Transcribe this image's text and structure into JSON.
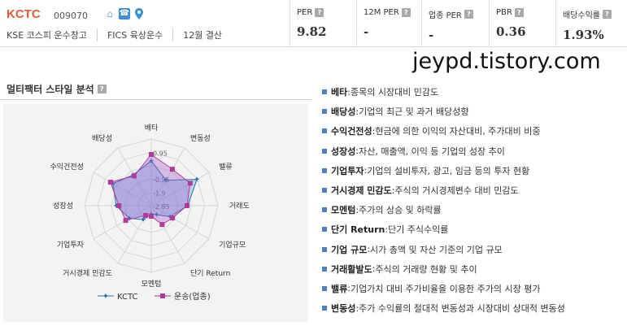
{
  "header": {
    "company_name": "KCTC",
    "company_code": "009070",
    "sub": [
      "KSE  코스피 운수창고",
      "FICS 육상운수",
      "12월 결산"
    ],
    "icons": [
      "home-icon",
      "phone-icon",
      "location-icon"
    ]
  },
  "metrics": [
    {
      "label": "PER",
      "value": "9.82"
    },
    {
      "label": "12M PER",
      "value": "-"
    },
    {
      "label": "업종 PER",
      "value": "-"
    },
    {
      "label": "PBR",
      "value": "0.36"
    },
    {
      "label": "배당수익률",
      "value": "1.93%"
    }
  ],
  "help_glyph": "?",
  "watermark": "jeypd.tistory.com",
  "panel": {
    "title": "멀티팩터 스타일 분석"
  },
  "chart_data": {
    "type": "radar",
    "axes": [
      "베타",
      "변동성",
      "밸류",
      "거래도",
      "기업규모",
      "단기 Return",
      "모멘텀",
      "거시경제 민감도",
      "기업투자",
      "성장성",
      "수익건전성",
      "배당성"
    ],
    "ticks": [
      "0.95",
      "-0.95",
      "-1.9",
      "-2.85"
    ],
    "range": [
      -2.85,
      1.9
    ],
    "series": [
      {
        "name": "KCTC",
        "color": "#2a6fb0",
        "values": [
          0.35,
          -0.75,
          0.9,
          -0.25,
          -1.3,
          -2.1,
          -2.25,
          -1.7,
          -1.05,
          -0.35,
          0.3,
          -0.3
        ]
      },
      {
        "name": "운송(업종)",
        "color": "#b03a9a",
        "values": [
          0.8,
          0.15,
          0.35,
          -0.3,
          -1.1,
          -1.3,
          -2.1,
          -2.05,
          -0.75,
          -0.55,
          0.5,
          -0.4
        ]
      }
    ],
    "legend_position": "bottom"
  },
  "factor_list": [
    {
      "name": "베타",
      "desc": "종목의 시장대비 민감도"
    },
    {
      "name": "배당성",
      "desc": "기업의 최근 및 과거 배당성향"
    },
    {
      "name": "수익건전성",
      "desc": "현금에 의한 이익의 자산대비, 주가대비 비중"
    },
    {
      "name": "성장성",
      "desc": "자산, 매출액, 이익 등 기업의 성장 추이"
    },
    {
      "name": "기업투자",
      "desc": "기업의 설비투자, 광고, 임금 등의 투자 현황"
    },
    {
      "name": "거시경제 민감도",
      "desc": "주식의 거시경제변수 대비 민감도"
    },
    {
      "name": "모멘텀",
      "desc": "주가의 상승 및 하락률"
    },
    {
      "name": "단기 Return",
      "desc": "단기 주식수익률"
    },
    {
      "name": "기업 규모",
      "desc": "시가 총액 및 자산 기준의 기업 규모"
    },
    {
      "name": "거래활발도",
      "desc": "주식의 거래량 현황 및 추이"
    },
    {
      "name": "밸류",
      "desc": "기업가치 대비 주가비율을 이용한 주가의 시장 평가"
    },
    {
      "name": "변동성",
      "desc": "주가 수익률의 절대적 변동성과 시장대비 상대적 변동성"
    }
  ]
}
